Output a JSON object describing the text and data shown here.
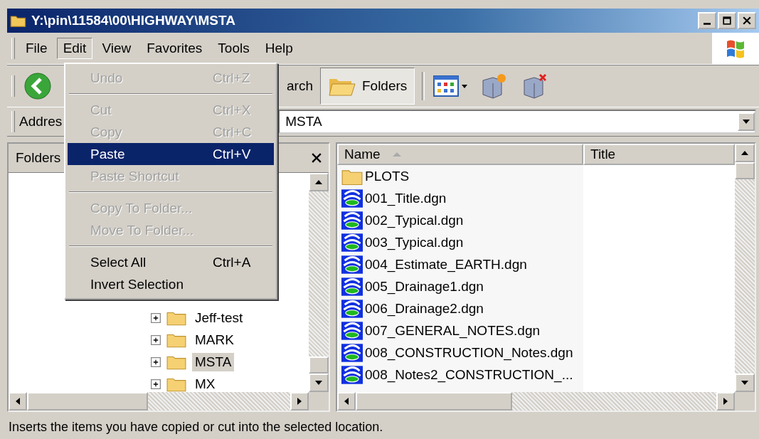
{
  "window": {
    "title": "Y:\\pin\\11584\\00\\HIGHWAY\\MSTA"
  },
  "menu_bar": [
    {
      "label": "File",
      "selected": false
    },
    {
      "label": "Edit",
      "selected": true
    },
    {
      "label": "View",
      "selected": false
    },
    {
      "label": "Favorites",
      "selected": false
    },
    {
      "label": "Tools",
      "selected": false
    },
    {
      "label": "Help",
      "selected": false
    }
  ],
  "toolbar": {
    "search_fragment": "arch",
    "folders_button": {
      "label": "Folders",
      "pressed": true
    }
  },
  "address_bar": {
    "label": "Addres",
    "value": "MSTA"
  },
  "edit_menu": [
    {
      "kind": "item",
      "label": "Undo",
      "shortcut": "Ctrl+Z",
      "disabled": true,
      "selected": false
    },
    {
      "kind": "separator"
    },
    {
      "kind": "item",
      "label": "Cut",
      "shortcut": "Ctrl+X",
      "disabled": true,
      "selected": false
    },
    {
      "kind": "item",
      "label": "Copy",
      "shortcut": "Ctrl+C",
      "disabled": true,
      "selected": false
    },
    {
      "kind": "item",
      "label": "Paste",
      "shortcut": "Ctrl+V",
      "disabled": false,
      "selected": true
    },
    {
      "kind": "item",
      "label": "Paste Shortcut",
      "disabled": true,
      "selected": false
    },
    {
      "kind": "separator"
    },
    {
      "kind": "item",
      "label": "Copy To Folder...",
      "disabled": true,
      "selected": false
    },
    {
      "kind": "item",
      "label": "Move To Folder...",
      "disabled": true,
      "selected": false
    },
    {
      "kind": "separator"
    },
    {
      "kind": "item",
      "label": "Select All",
      "shortcut": "Ctrl+A",
      "disabled": false,
      "selected": false
    },
    {
      "kind": "item",
      "label": "Invert Selection",
      "disabled": false,
      "selected": false
    }
  ],
  "folders_pane": {
    "title": "Folders",
    "items": [
      {
        "label": "Jeff-test",
        "selected": false
      },
      {
        "label": "MARK",
        "selected": false
      },
      {
        "label": "MSTA",
        "selected": true
      },
      {
        "label": "MX",
        "selected": false
      }
    ]
  },
  "file_list": {
    "columns": [
      {
        "label": "Name",
        "sorted": true
      },
      {
        "label": "Title",
        "sorted": false
      }
    ],
    "rows": [
      {
        "name": "PLOTS",
        "kind": "folder"
      },
      {
        "name": "001_Title.dgn",
        "kind": "dgn"
      },
      {
        "name": "002_Typical.dgn",
        "kind": "dgn"
      },
      {
        "name": "003_Typical.dgn",
        "kind": "dgn"
      },
      {
        "name": "004_Estimate_EARTH.dgn",
        "kind": "dgn"
      },
      {
        "name": "005_Drainage1.dgn",
        "kind": "dgn"
      },
      {
        "name": "006_Drainage2.dgn",
        "kind": "dgn"
      },
      {
        "name": "007_GENERAL_NOTES.dgn",
        "kind": "dgn"
      },
      {
        "name": "008_CONSTRUCTION_Notes.dgn",
        "kind": "dgn"
      },
      {
        "name": "008_Notes2_CONSTRUCTION_...",
        "kind": "dgn"
      }
    ]
  },
  "status_bar": {
    "text": "Inserts the items you have copied or cut into the selected location."
  }
}
